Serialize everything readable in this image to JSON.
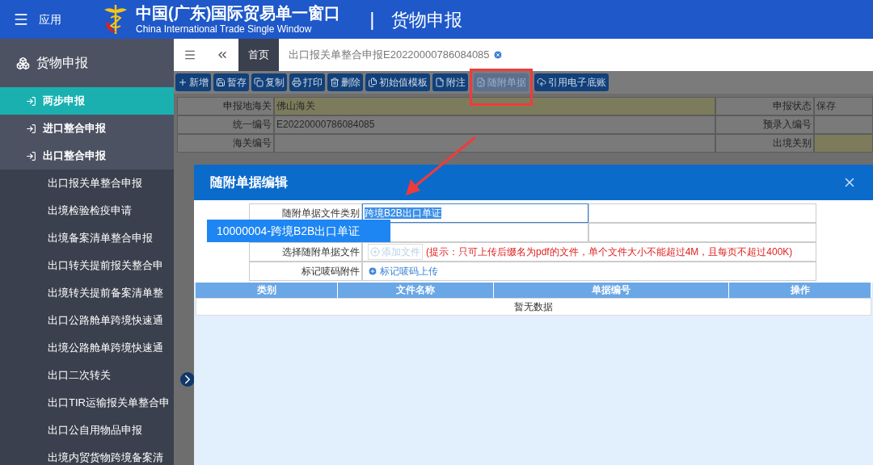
{
  "header": {
    "menu_label": "应用",
    "title": "中国(广东)国际贸易单一窗口",
    "subtitle": "China International Trade Single Window",
    "separator": "|",
    "section": "货物申报"
  },
  "sidebar": {
    "title": "货物申报",
    "items": [
      {
        "label": "两步申报",
        "selected": true
      },
      {
        "label": "进口整合申报",
        "selected": false
      },
      {
        "label": "出口整合申报",
        "selected": false,
        "children": [
          {
            "label": "出口报关单整合申报"
          },
          {
            "label": "出境检验检疫申请"
          },
          {
            "label": "出境备案清单整合申报"
          },
          {
            "label": "出口转关提前报关整合申"
          },
          {
            "label": "出境转关提前备案清单整"
          },
          {
            "label": "出口公路舱单跨境快速通"
          },
          {
            "label": "出境公路舱单跨境快速通"
          },
          {
            "label": "出口二次转关"
          },
          {
            "label": "出口TIR运输报关单整合申"
          },
          {
            "label": "出口公自用物品申报"
          },
          {
            "label": "出境内贸货物跨境备案清"
          }
        ]
      }
    ]
  },
  "tabs": [
    {
      "label": "首页",
      "kind": "home"
    },
    {
      "label": "出口报关单整合申报E20220000786084085",
      "kind": "page"
    }
  ],
  "toolbar": [
    {
      "label": "新增",
      "disabled": false
    },
    {
      "label": "暂存",
      "disabled": false
    },
    {
      "label": "复制",
      "disabled": false
    },
    {
      "label": "打印",
      "disabled": false
    },
    {
      "label": "删除",
      "disabled": false
    },
    {
      "label": "初始值模板",
      "disabled": false
    },
    {
      "label": "附注",
      "disabled": false
    },
    {
      "label": "随附单据",
      "disabled": true,
      "marked": true
    },
    {
      "label": "引用电子底账",
      "disabled": false
    }
  ],
  "form": {
    "left": [
      {
        "label": "申报地海关",
        "value": "佛山海关",
        "required": true
      },
      {
        "label": "统一编号",
        "value": "E20220000786084085",
        "required": false
      },
      {
        "label": "海关编号",
        "required": false
      }
    ],
    "right": [
      {
        "label": "申报状态",
        "value": "保存",
        "required": false
      },
      {
        "label": "预录入编号",
        "required": false
      },
      {
        "label": "出境关别",
        "required": true
      }
    ]
  },
  "modal": {
    "title": "随附单据编辑",
    "fields": [
      {
        "kind": "input",
        "label": "随附单据文件类别",
        "value": "跨境B2B出口单证"
      },
      {
        "kind": "blank"
      },
      {
        "kind": "upload",
        "label": "选择随附单据文件",
        "button": "添加文件",
        "hint": "(提示：只可上传后缀名为pdf的文件，单个文件大小不能超过4M，且每页不超过400K)"
      },
      {
        "kind": "link",
        "label": "标记唛码附件",
        "link": "标记唛码上传"
      }
    ],
    "dropdown": [
      "10000004-跨境B2B出口单证"
    ],
    "columns": [
      "类别",
      "文件名称",
      "单据编号",
      "操作"
    ],
    "empty": "暂无数据"
  }
}
